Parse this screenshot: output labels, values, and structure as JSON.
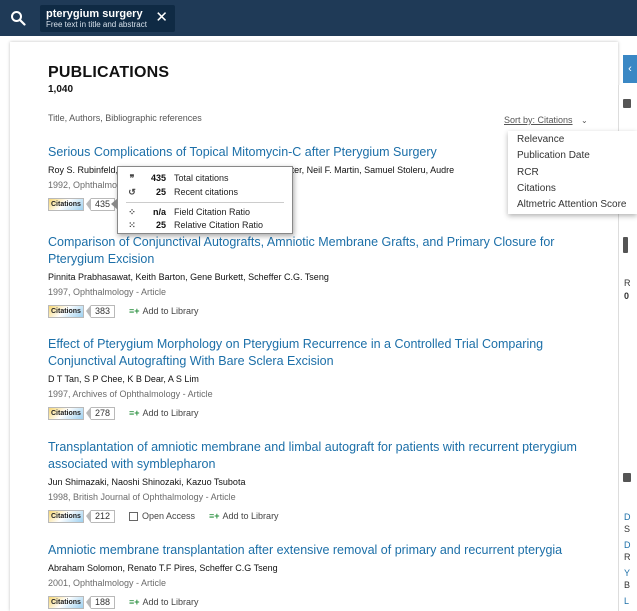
{
  "search": {
    "query": "pterygium surgery",
    "scope": "Free text in title and abstract"
  },
  "publications": {
    "heading": "PUBLICATIONS",
    "count": "1,040",
    "scope_line": "Title, Authors, Bibliographic references",
    "sort_label": "Sort by: Citations",
    "sort_options": [
      "Relevance",
      "Publication Date",
      "RCR",
      "Citations",
      "Altmetric Attention Score"
    ]
  },
  "items": [
    {
      "title": "Serious Complications of Topical Mitomycin-C after Pterygium Surgery",
      "authors": "Roy S. Rubinfeld, R",
      "authors_tail": "phen Foster, Neil F. Martin, Samuel Stoleru, Audre",
      "meta": "1992, Ophthalmol",
      "citations": "435",
      "actions": []
    },
    {
      "title": "Comparison of Conjunctival Autografts, Amniotic Membrane Grafts, and Primary Closure for Pterygium Excision",
      "authors": "Pinnita Prabhasawat, Keith Barton, Gene Burkett, Scheffer C.G. Tseng",
      "meta": "1997, Ophthalmology - Article",
      "citations": "383",
      "actions": [
        "Add to Library"
      ]
    },
    {
      "title": "Effect of Pterygium Morphology on Pterygium Recurrence in a Controlled Trial Comparing Conjunctival Autografting With Bare Sclera Excision",
      "authors": "D T Tan, S P Chee, K B Dear, A S Lim",
      "meta": "1997, Archives of Ophthalmology - Article",
      "citations": "278",
      "actions": [
        "Add to Library"
      ]
    },
    {
      "title": "Transplantation of amniotic membrane and limbal autograft for patients with recurrent pterygium associated with symblepharon",
      "authors": "Jun Shimazaki, Naoshi Shinozaki, Kazuo Tsubota",
      "meta": "1998, British Journal of Ophthalmology - Article",
      "citations": "212",
      "actions": [
        "Open Access",
        "Add to Library"
      ]
    },
    {
      "title": "Amniotic membrane transplantation after extensive removal of primary and recurrent pterygia",
      "authors": "Abraham Solomon, Renato T.F Pires, Scheffer C.G Tseng",
      "meta": "2001, Ophthalmology - Article",
      "citations": "188",
      "actions": [
        "Add to Library"
      ]
    }
  ],
  "citation_badge_label": "Citations",
  "popover": {
    "total_citations_value": "435",
    "total_citations_label": "Total citations",
    "recent_citations_value": "25",
    "recent_citations_label": "Recent citations",
    "fcr_value": "n/a",
    "fcr_label": "Field Citation Ratio",
    "rcr_value": "25",
    "rcr_label": "Relative Citation Ratio"
  },
  "right_panel": {
    "tab_glyph": "‹",
    "frag_r": "R",
    "frag_0": "0",
    "frag_d1": "D",
    "frag_s": "S",
    "frag_d2": "D",
    "frag_r2": "R",
    "frag_y": "Y",
    "frag_b": "B",
    "frag_l": "L"
  },
  "colors": {
    "topbar": "#1f3a57",
    "link": "#1c6fa8",
    "accent": "#3a87c4"
  }
}
